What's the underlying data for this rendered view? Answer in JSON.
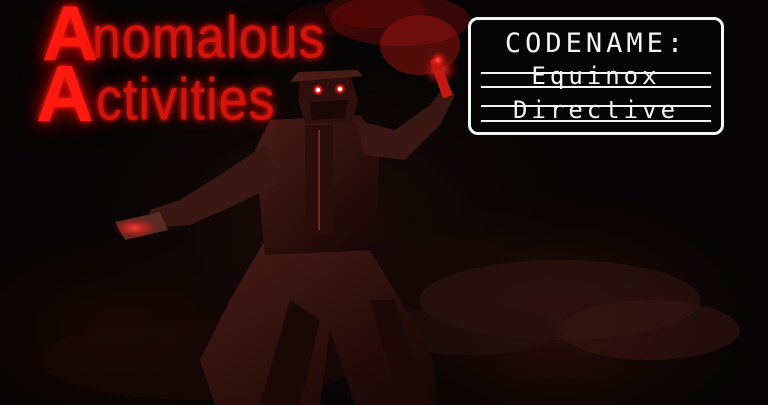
{
  "title": {
    "line1_cap": "A",
    "line1_rest": "nomalous",
    "line2_cap": "A",
    "line2_rest": "ctivities"
  },
  "codename": {
    "label": "CODENAME:",
    "word1": "Equinox",
    "word2": "Directive"
  },
  "colors": {
    "title_red": "#ff1a10",
    "box_white": "#f4f4f4",
    "background": "#060404"
  }
}
